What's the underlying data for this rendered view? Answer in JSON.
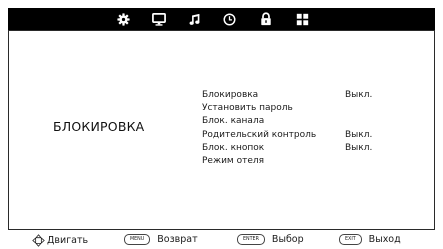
{
  "tabs": [
    {
      "icon": "gear-icon",
      "label": "Settings"
    },
    {
      "icon": "monitor-icon",
      "label": "Picture"
    },
    {
      "icon": "music-note-icon",
      "label": "Sound"
    },
    {
      "icon": "clock-icon",
      "label": "Time"
    },
    {
      "icon": "lock-icon",
      "label": "Lock",
      "selected": true
    },
    {
      "icon": "grid-icon",
      "label": "Apps"
    }
  ],
  "section_title": "БЛОКИРОВКА",
  "menu": [
    {
      "label": "Блокировка",
      "value": "Выкл."
    },
    {
      "label": "Установить пароль",
      "value": ""
    },
    {
      "label": "Блок. канала",
      "value": ""
    },
    {
      "label": "Родительский контроль",
      "value": "Выкл."
    },
    {
      "label": "Блок. кнопок",
      "value": "Выкл."
    },
    {
      "label": "Режим отеля",
      "value": ""
    }
  ],
  "footer": {
    "move": {
      "icon": "dpad-icon",
      "label": "Двигать"
    },
    "back": {
      "key": "MENU",
      "label": "Возврат"
    },
    "select": {
      "key": "ENTER",
      "label": "Выбор"
    },
    "exit": {
      "key": "EXIT",
      "label": "Выход"
    }
  },
  "colors": {
    "tabbar_bg": "#000000",
    "icon": "#ffffff",
    "text": "#1a1a1a",
    "panel_bg": "#ffffff"
  }
}
